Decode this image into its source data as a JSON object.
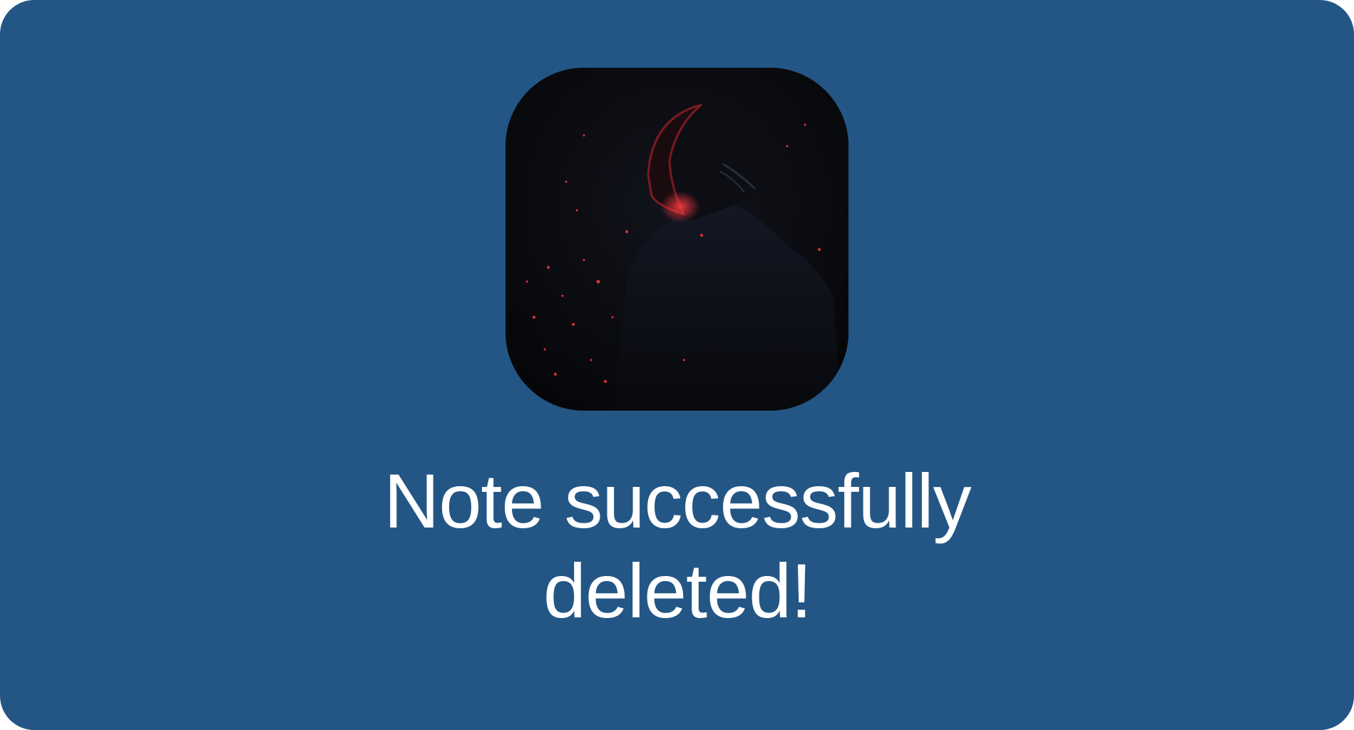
{
  "toast": {
    "message": "Note successfully deleted!",
    "image": {
      "icon": "hooded-figure-artwork",
      "description_colors": {
        "background": "#235685",
        "artwork_base": "#07070a",
        "accent_glow": "#e0313a"
      }
    }
  }
}
